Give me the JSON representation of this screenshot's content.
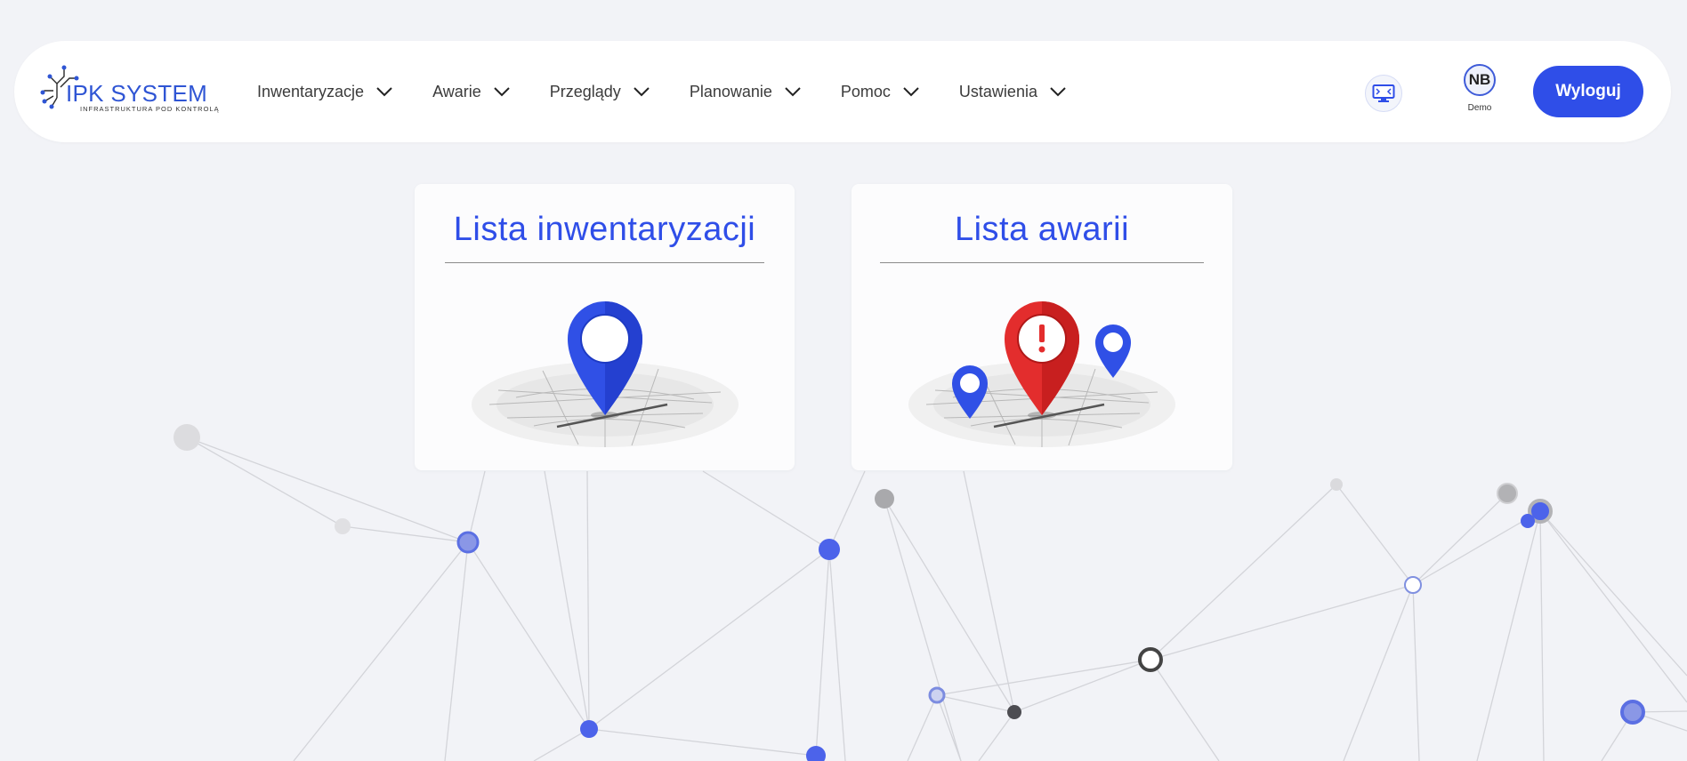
{
  "logo": {
    "title": "IPK SYSTEM",
    "subtitle": "INFRASTRUKTURA POD KONTROLĄ"
  },
  "nav": {
    "items": [
      {
        "label": "Inwentaryzacje",
        "icon": "chevron-down-icon"
      },
      {
        "label": "Awarie",
        "icon": "chevron-down-icon"
      },
      {
        "label": "Przeglądy",
        "icon": "chevron-down-icon"
      },
      {
        "label": "Planowanie",
        "icon": "chevron-down-icon"
      },
      {
        "label": "Pomoc",
        "icon": "chevron-down-icon"
      },
      {
        "label": "Ustawienia",
        "icon": "chevron-down-icon"
      }
    ]
  },
  "user": {
    "initials": "NB",
    "name": "Demo",
    "screen_icon": "monitor-icon"
  },
  "logout_label": "Wyloguj",
  "cards": [
    {
      "title": "Lista inwentaryzacji",
      "icon": "map-pin-icon"
    },
    {
      "title": "Lista awarii",
      "icon": "alert-map-pin-icon"
    }
  ],
  "colors": {
    "accent": "#2f4ee8",
    "alert": "#e02a2a",
    "background": "#f2f3f7"
  }
}
